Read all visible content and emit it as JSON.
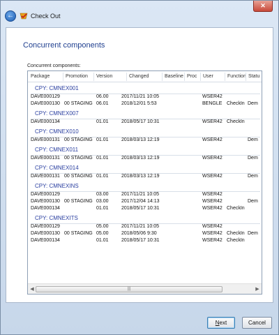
{
  "window": {
    "title": "Check Out",
    "close_label": "✕"
  },
  "page": {
    "heading": "Concurrent components",
    "list_label": "Concurrent components:"
  },
  "table": {
    "columns": [
      "Package",
      "Promotion",
      "Version",
      "Changed",
      "Baseline",
      "Proc",
      "User",
      "Function",
      "Statu"
    ],
    "groups": [
      {
        "label": "CPY:  CMNEX001",
        "rows": [
          [
            "DAVE000129",
            "",
            "06.00",
            "2017/11/21  10:05",
            "",
            "",
            "WSER42",
            "",
            ""
          ],
          [
            "DAVE000130",
            "00 STAGING",
            "06.01",
            "2018/12/01  5:53",
            "",
            "",
            "BENGLE",
            "CheckIn",
            "Dem"
          ]
        ]
      },
      {
        "label": "CPY:  CMNEX007",
        "rows": [
          [
            "DAVE000134",
            "",
            "01.01",
            "2018/05/17  10:31",
            "",
            "",
            "WSER42",
            "CheckIn",
            ""
          ]
        ]
      },
      {
        "label": "CPY:  CMNEX010",
        "rows": [
          [
            "DAVE000131",
            "00 STAGING",
            "01.01",
            "2018/03/13  12:19",
            "",
            "",
            "WSER42",
            "",
            "Dem"
          ]
        ]
      },
      {
        "label": "CPY:  CMNEX011",
        "rows": [
          [
            "DAVE000131",
            "00 STAGING",
            "01.01",
            "2018/03/13  12:19",
            "",
            "",
            "WSER42",
            "",
            "Dem"
          ]
        ]
      },
      {
        "label": "CPY:  CMNEX014",
        "rows": [
          [
            "DAVE000131",
            "00 STAGING",
            "01.01",
            "2018/03/13  12:19",
            "",
            "",
            "WSER42",
            "",
            "Dem"
          ]
        ]
      },
      {
        "label": "CPY:  CMNEXINS",
        "rows": [
          [
            "DAVE000129",
            "",
            "03.00",
            "2017/11/21  10:05",
            "",
            "",
            "WSER42",
            "",
            ""
          ],
          [
            "DAVE000130",
            "00 STAGING",
            "03.00",
            "2017/12/04  14:13",
            "",
            "",
            "WSER42",
            "",
            "Dem"
          ],
          [
            "DAVE000134",
            "",
            "01.01",
            "2018/05/17  10:31",
            "",
            "",
            "WSER42",
            "CheckIn",
            ""
          ]
        ]
      },
      {
        "label": "CPY:  CMNEXITS",
        "rows": [
          [
            "DAVE000129",
            "",
            "05.00",
            "2017/11/21  10:05",
            "",
            "",
            "WSER42",
            "",
            ""
          ],
          [
            "DAVE000130",
            "00 STAGING",
            "05.00",
            "2018/05/06  9:30",
            "",
            "",
            "WSER42",
            "CheckIn",
            "Dem"
          ],
          [
            "DAVE000134",
            "",
            "01.01",
            "2018/05/17  10:31",
            "",
            "",
            "WSER42",
            "CheckIn",
            ""
          ]
        ]
      }
    ]
  },
  "scrollbar": {
    "left_arrow": "◀",
    "right_arrow": "▶",
    "grip": "|||"
  },
  "buttons": {
    "next_mnemonic": "N",
    "next_rest": "ext",
    "cancel": "Cancel"
  }
}
